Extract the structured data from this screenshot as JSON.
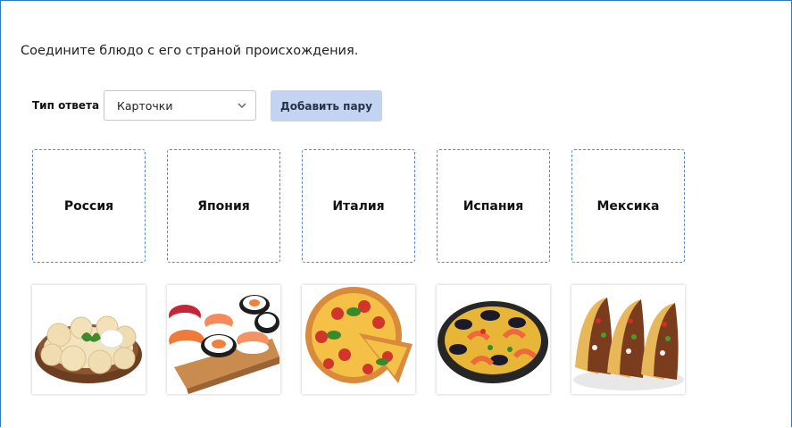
{
  "question": "Соедините блюдо с его страной происхождения.",
  "answer_type": {
    "label": "Тип ответа",
    "selected": "Карточки"
  },
  "add_pair_button": "Добавить пару",
  "countries": [
    "Россия",
    "Япония",
    "Италия",
    "Испания",
    "Мексика"
  ],
  "dishes": [
    {
      "icon": "dumplings-image"
    },
    {
      "icon": "sushi-image"
    },
    {
      "icon": "pizza-image"
    },
    {
      "icon": "paella-image"
    },
    {
      "icon": "tacos-image"
    }
  ],
  "colors": {
    "frame_border": "#2f7bbd",
    "card_border": "#5b86c7",
    "button_bg": "#c3d3f2"
  }
}
